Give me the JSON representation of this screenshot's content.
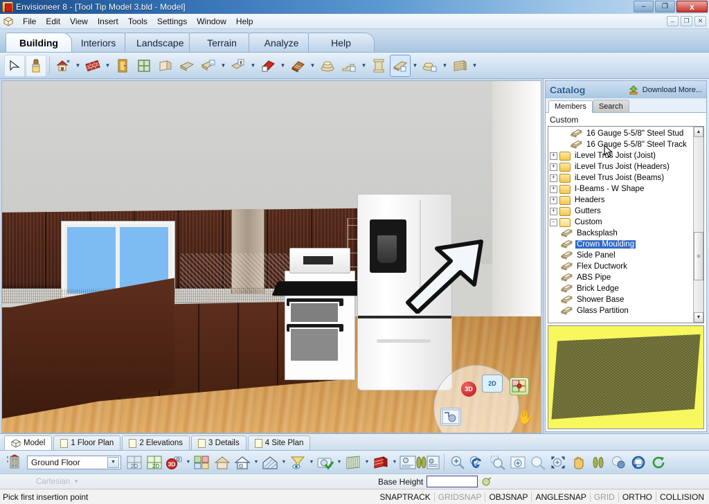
{
  "window": {
    "title": "Envisioneer 8 - [Tool Tip Model 3.bld - Model]",
    "app_icon": "envisioneer-app-icon",
    "minimize": "–",
    "maximize": "❐",
    "close": "x",
    "mdi_minimize": "–",
    "mdi_restore": "❐",
    "mdi_close": "✕"
  },
  "menubar": {
    "doc_icon": "cube-icon",
    "items": [
      "File",
      "Edit",
      "View",
      "Insert",
      "Tools",
      "Settings",
      "Window",
      "Help"
    ]
  },
  "ribbon": {
    "tabs": [
      {
        "label": "Building",
        "active": true
      },
      {
        "label": "Interiors",
        "active": false
      },
      {
        "label": "Landscape",
        "active": false
      },
      {
        "label": "Terrain",
        "active": false
      },
      {
        "label": "Analyze",
        "active": false
      },
      {
        "label": "Help",
        "active": false
      }
    ]
  },
  "toolbar": {
    "buttons": [
      {
        "name": "select-arrow-tool",
        "icon": "cursor-arrow-icon",
        "caret": false,
        "state": "boxed"
      },
      {
        "name": "paintbrush-tool",
        "icon": "paintbrush-icon",
        "caret": false,
        "state": "boxed"
      },
      {
        "name": "house-wizard-tool",
        "icon": "house-wand-icon",
        "caret": true,
        "state": "normal"
      },
      {
        "name": "wall-tool",
        "icon": "brick-wall-icon",
        "caret": true,
        "state": "normal"
      },
      {
        "name": "door-tool",
        "icon": "door-icon",
        "caret": false,
        "state": "normal"
      },
      {
        "name": "window-tool",
        "icon": "window-icon",
        "caret": false,
        "state": "normal"
      },
      {
        "name": "opening-tool",
        "icon": "wall-opening-icon",
        "caret": false,
        "state": "normal"
      },
      {
        "name": "floor-tool",
        "icon": "floor-deck-icon",
        "caret": false,
        "state": "normal"
      },
      {
        "name": "stairs-down-tool",
        "icon": "stair-down-icon",
        "caret": true,
        "state": "normal"
      },
      {
        "name": "stairs-up-tool",
        "icon": "stair-up-icon",
        "caret": true,
        "state": "normal"
      },
      {
        "name": "roof-tool",
        "icon": "roof-icon",
        "caret": true,
        "state": "normal"
      },
      {
        "name": "roof-plane-tool",
        "icon": "roof-plane-icon",
        "caret": true,
        "state": "normal"
      },
      {
        "name": "deck-tool",
        "icon": "deck-stack-icon",
        "caret": false,
        "state": "normal"
      },
      {
        "name": "railing-tool",
        "icon": "railing-stairs-icon",
        "caret": true,
        "state": "normal"
      },
      {
        "name": "column-tool",
        "icon": "column-icon",
        "caret": false,
        "state": "normal"
      },
      {
        "name": "beam-tool",
        "icon": "beam-icon",
        "caret": true,
        "state": "selected"
      },
      {
        "name": "framing-tool",
        "icon": "framing-icon",
        "caret": true,
        "state": "normal"
      },
      {
        "name": "custom-shape-tool",
        "icon": "custom-slab-icon",
        "caret": true,
        "state": "normal"
      }
    ]
  },
  "catalog": {
    "title": "Catalog",
    "download_icon": "download-more-icon",
    "download_label": "Download More...",
    "tabs": [
      {
        "label": "Members",
        "active": true
      },
      {
        "label": "Search",
        "active": false
      }
    ],
    "section_label": "Custom",
    "tree": [
      {
        "label": "16 Gauge 5-5/8\" Steel Stud",
        "type": "part",
        "indent": 2,
        "expander": null,
        "selected": false
      },
      {
        "label": "16 Gauge 5-5/8\" Steel Track",
        "type": "part",
        "indent": 2,
        "expander": null,
        "selected": false
      },
      {
        "label": "iLevel Trus Joist (Joist)",
        "type": "folder",
        "indent": 0,
        "expander": "+",
        "selected": false
      },
      {
        "label": "iLevel Trus Joist (Headers)",
        "type": "folder",
        "indent": 0,
        "expander": "+",
        "selected": false
      },
      {
        "label": "iLevel Trus Joist (Beams)",
        "type": "folder",
        "indent": 0,
        "expander": "+",
        "selected": false
      },
      {
        "label": "I-Beams - W Shape",
        "type": "folder",
        "indent": 0,
        "expander": "+",
        "selected": false
      },
      {
        "label": "Headers",
        "type": "folder",
        "indent": 0,
        "expander": "+",
        "selected": false
      },
      {
        "label": "Gutters",
        "type": "folder",
        "indent": 0,
        "expander": "+",
        "selected": false
      },
      {
        "label": "Custom",
        "type": "folder-open",
        "indent": 0,
        "expander": "-",
        "selected": false
      },
      {
        "label": "Backsplash",
        "type": "part",
        "indent": 1,
        "expander": null,
        "selected": false
      },
      {
        "label": "Crown Moulding",
        "type": "part",
        "indent": 1,
        "expander": null,
        "selected": true
      },
      {
        "label": "Side Panel",
        "type": "part",
        "indent": 1,
        "expander": null,
        "selected": false
      },
      {
        "label": "Flex Ductwork",
        "type": "part",
        "indent": 1,
        "expander": null,
        "selected": false
      },
      {
        "label": "ABS Pipe",
        "type": "part",
        "indent": 1,
        "expander": null,
        "selected": false
      },
      {
        "label": "Brick Ledge",
        "type": "part",
        "indent": 1,
        "expander": null,
        "selected": false
      },
      {
        "label": "Shower Base",
        "type": "part",
        "indent": 1,
        "expander": null,
        "selected": false
      },
      {
        "label": "Glass Partition",
        "type": "part",
        "indent": 1,
        "expander": null,
        "selected": false
      }
    ],
    "scroll_up": "▲",
    "scroll_down": "▼",
    "preview_name": "material-preview-swatch"
  },
  "viewport": {
    "annotation_arrow": "large-white-arrow-annotation",
    "nav_widget": {
      "btn_3d": "3D",
      "btn_2d": "2D",
      "cube": "view-cube-icon",
      "hand": "pan-hand-icon",
      "target": "camera-target-icon"
    }
  },
  "doctabs": [
    {
      "label": "Model",
      "icon": "cube-icon",
      "active": true
    },
    {
      "label": "1 Floor Plan",
      "icon": "page-icon",
      "active": false
    },
    {
      "label": "2 Elevations",
      "icon": "page-icon",
      "active": false
    },
    {
      "label": "3 Details",
      "icon": "page-icon",
      "active": false
    },
    {
      "label": "4 Site Plan",
      "icon": "page-icon",
      "active": false
    }
  ],
  "bottombar": {
    "level_icon": "building-levels-icon",
    "floor_value": "Ground Floor",
    "floor_caret": "▼",
    "buttons": [
      {
        "name": "view-2d-grey-button",
        "icon": "2d-grey-icon",
        "caret": false
      },
      {
        "name": "view-2d-button",
        "icon": "2d-green-icon",
        "caret": false
      },
      {
        "name": "view-3d-camera-button",
        "icon": "3d-camera-icon",
        "caret": true
      },
      {
        "name": "layers-button",
        "icon": "layers-color-icon",
        "caret": false
      },
      {
        "name": "house-solid-button",
        "icon": "house-solid-icon",
        "caret": false
      },
      {
        "name": "house-outline-button",
        "icon": "house-outline-icon",
        "caret": true
      },
      {
        "name": "house-hatch-button",
        "icon": "house-hatch-icon",
        "caret": true
      },
      {
        "name": "filter-view-button",
        "icon": "funnel-eye-icon",
        "caret": true
      },
      {
        "name": "snapshot-button",
        "icon": "camera-check-icon",
        "caret": true
      },
      {
        "name": "section-button",
        "icon": "section-fence-icon",
        "caret": true
      },
      {
        "name": "material-button",
        "icon": "brick-block-icon",
        "caret": true
      },
      {
        "name": "walkthrough-button",
        "icon": "walkthrough-icon",
        "caret": false
      },
      {
        "name": "zoom-in-button",
        "icon": "zoom-in-icon",
        "caret": false
      },
      {
        "name": "zoom-previous-button",
        "icon": "zoom-previous-icon",
        "caret": false
      },
      {
        "name": "zoom-selected-button",
        "icon": "zoom-selected-icon",
        "caret": false
      },
      {
        "name": "zoom-window-button",
        "icon": "zoom-window-icon",
        "caret": false
      },
      {
        "name": "zoom-all-button",
        "icon": "zoom-all-icon",
        "caret": false
      },
      {
        "name": "zoom-extents-button",
        "icon": "zoom-extents-icon",
        "caret": false
      },
      {
        "name": "pan-button",
        "icon": "pan-hand-icon",
        "caret": false
      },
      {
        "name": "walk-button",
        "icon": "footsteps-icon",
        "caret": false
      },
      {
        "name": "orbit-button",
        "icon": "orbit-spheres-icon",
        "caret": false
      },
      {
        "name": "rotate-view-button",
        "icon": "rotate-view-icon",
        "caret": false
      },
      {
        "name": "refresh-button",
        "icon": "refresh-icon",
        "caret": false
      }
    ]
  },
  "coordbar": {
    "cartesian_label": "Cartesian",
    "cartesian_caret": "▼",
    "base_height_label": "Base Height",
    "base_height_value": "",
    "base_height_icon": "pick-height-icon"
  },
  "statusbar": {
    "message": "Pick first insertion point",
    "snaps": [
      {
        "label": "SNAPTRACK",
        "on": true
      },
      {
        "label": "GRIDSNAP",
        "on": false
      },
      {
        "label": "OBJSNAP",
        "on": true
      },
      {
        "label": "ANGLESNAP",
        "on": true
      },
      {
        "label": "GRID",
        "on": false
      },
      {
        "label": "ORTHO",
        "on": true
      },
      {
        "label": "COLLISION",
        "on": true
      }
    ]
  }
}
